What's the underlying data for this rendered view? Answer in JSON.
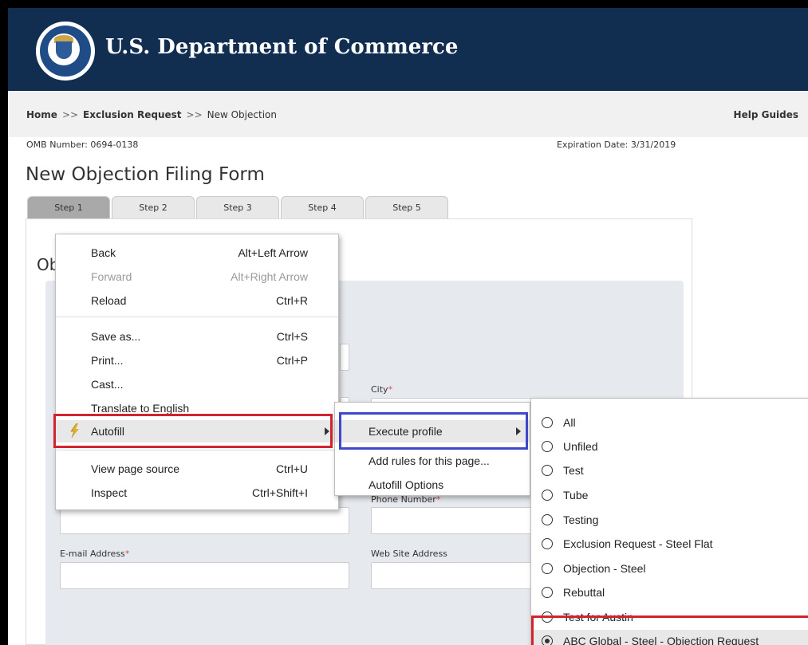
{
  "header": {
    "title": "U.S. Department of Commerce",
    "seal_icon": "commerce-seal-icon"
  },
  "breadcrumb": {
    "home": "Home",
    "sep": ">>",
    "exclusion": "Exclusion Request",
    "current": "New Objection"
  },
  "help_guides": "Help Guides",
  "omb": "OMB Number: 0694-0138",
  "expiration": "Expiration Date: 3/31/2019",
  "form_title": "New Objection Filing Form",
  "tabs": [
    {
      "label": "Step 1",
      "active": true
    },
    {
      "label": "Step 2"
    },
    {
      "label": "Step 3"
    },
    {
      "label": "Step 4"
    },
    {
      "label": "Step 5"
    }
  ],
  "section_title": "Ob",
  "fields": {
    "city": "City",
    "phone": "Phone Number",
    "email": "E-mail Address",
    "website": "Web Site Address",
    "required_mark": "*"
  },
  "context_menu": {
    "items": [
      {
        "label": "Back",
        "shortcut": "Alt+Left Arrow"
      },
      {
        "label": "Forward",
        "shortcut": "Alt+Right Arrow",
        "disabled": true
      },
      {
        "label": "Reload",
        "shortcut": "Ctrl+R"
      },
      {
        "label": "Save as...",
        "shortcut": "Ctrl+S"
      },
      {
        "label": "Print...",
        "shortcut": "Ctrl+P"
      },
      {
        "label": "Cast..."
      },
      {
        "label": "Translate to English"
      },
      {
        "label": "Autofill",
        "icon": "autofill-lightning-icon",
        "has_submenu": true
      },
      {
        "label": "View page source",
        "shortcut": "Ctrl+U"
      },
      {
        "label": "Inspect",
        "shortcut": "Ctrl+Shift+I"
      }
    ]
  },
  "autofill_submenu": {
    "items": [
      {
        "label": "Execute profile",
        "has_submenu": true
      },
      {
        "label": "Add rules for this page..."
      },
      {
        "label": "Autofill Options"
      }
    ]
  },
  "profiles": {
    "items": [
      {
        "label": "All",
        "selected": false
      },
      {
        "label": "Unfiled",
        "selected": false
      },
      {
        "label": "Test",
        "selected": false
      },
      {
        "label": "Tube",
        "selected": false
      },
      {
        "label": "Testing",
        "selected": false
      },
      {
        "label": "Exclusion Request - Steel Flat",
        "selected": false
      },
      {
        "label": "Objection - Steel",
        "selected": false
      },
      {
        "label": "Rebuttal",
        "selected": false
      },
      {
        "label": "Test for Austin",
        "selected": false
      },
      {
        "label": "ABC Global - Steel - Objection Request",
        "selected": true
      }
    ]
  },
  "colors": {
    "header_bg": "#112e51",
    "highlight_red": "#d1242f",
    "highlight_blue": "#3f48c8"
  }
}
